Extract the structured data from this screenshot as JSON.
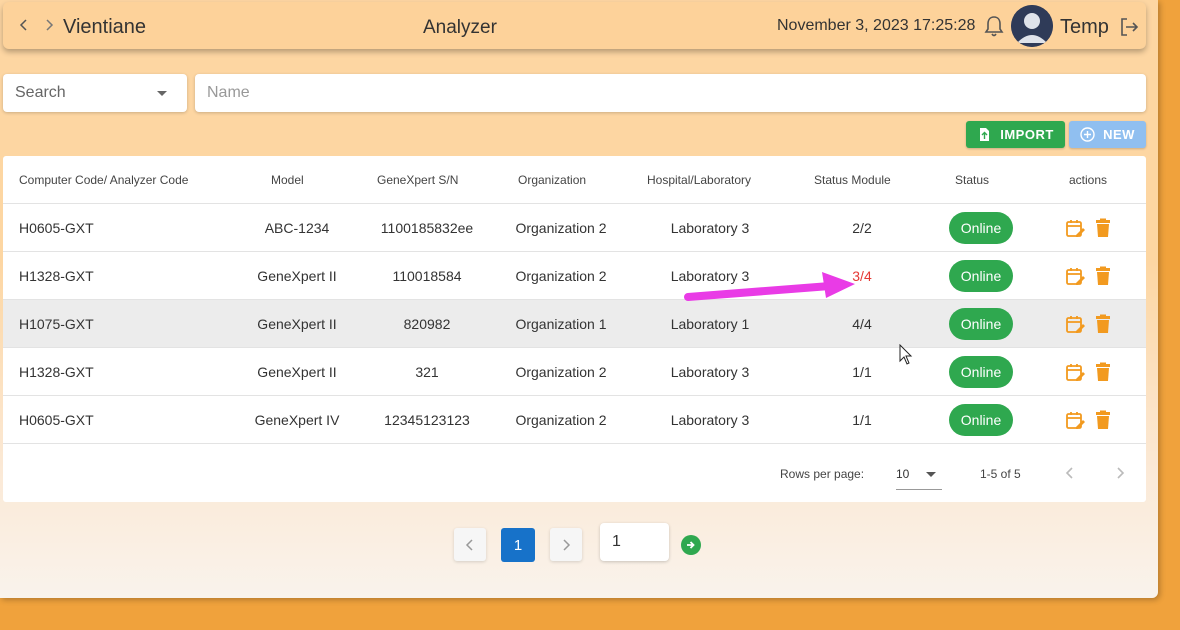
{
  "header": {
    "city": "Vientiane",
    "title": "Analyzer",
    "datetime": "November 3, 2023 17:25:28",
    "username": "Temp"
  },
  "filters": {
    "search_select": "Search",
    "name_placeholder": "Name"
  },
  "toolbar": {
    "import_label": "IMPORT",
    "new_label": "NEW"
  },
  "table": {
    "columns": [
      "Computer Code/ Analyzer Code",
      "Model",
      "GeneXpert S/N",
      "Organization",
      "Hospital/Laboratory",
      "Status Module",
      "Status",
      "actions"
    ],
    "rows": [
      {
        "code": "H0605-GXT",
        "model": "ABC-1234",
        "sn": "1100185832ee",
        "org": "Organization 2",
        "lab": "Laboratory 3",
        "module": "2/2",
        "status": "Online"
      },
      {
        "code": "H1328-GXT",
        "model": "GeneXpert II",
        "sn": "110018584",
        "org": "Organization 2",
        "lab": "Laboratory 3",
        "module": "3/4",
        "status": "Online"
      },
      {
        "code": "H1075-GXT",
        "model": "GeneXpert II",
        "sn": "820982",
        "org": "Organization 1",
        "lab": "Laboratory 1",
        "module": "4/4",
        "status": "Online"
      },
      {
        "code": "H1328-GXT",
        "model": "GeneXpert II",
        "sn": "321",
        "org": "Organization 2",
        "lab": "Laboratory 3",
        "module": "1/1",
        "status": "Online"
      },
      {
        "code": "H0605-GXT",
        "model": "GeneXpert IV",
        "sn": "12345123123",
        "org": "Organization 2",
        "lab": "Laboratory 3",
        "module": "1/1",
        "status": "Online"
      }
    ]
  },
  "footer": {
    "rows_per_page_label": "Rows per page:",
    "rows_per_page_value": "10",
    "range": "1-5 of 5"
  },
  "pager": {
    "current": "1",
    "input_value": "1"
  },
  "colors": {
    "header_bg": "#fdd29a",
    "accent_green": "#2fa84f",
    "accent_blue": "#1772c9",
    "action_orange": "#f29a1f",
    "alert_red": "#e53935",
    "annotation_magenta": "#e93be6"
  }
}
